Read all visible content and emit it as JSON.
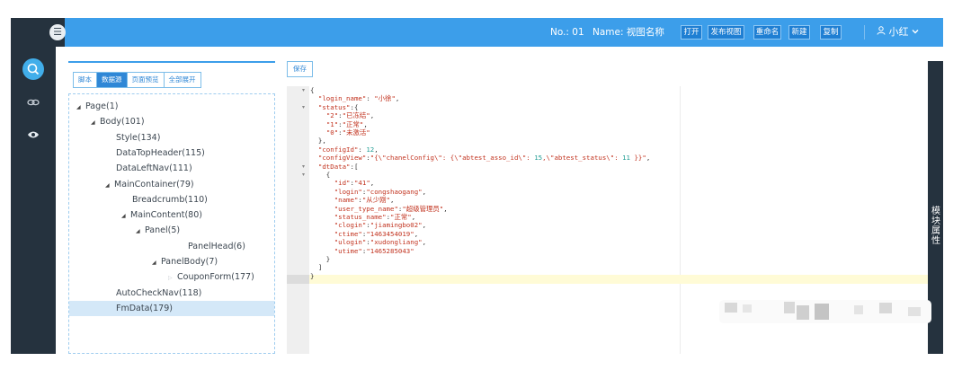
{
  "header": {
    "no_label": "No.: 01",
    "name_label": "Name: 视图名称",
    "buttons": [
      "打开",
      "发布视图",
      "重命名",
      "新建",
      "复制"
    ],
    "user": "小红",
    "menu_icon": "menu-icon",
    "user_icon": "user-icon",
    "dropdown_icon": "chevron-down-icon"
  },
  "sidebar": {
    "items": [
      {
        "icon": "search-icon",
        "active": true
      },
      {
        "icon": "link-icon",
        "active": false
      },
      {
        "icon": "eye-icon",
        "active": false
      }
    ]
  },
  "left_panel": {
    "tabs": [
      "脚本",
      "数据源",
      "页面预览",
      "全部展开"
    ],
    "active_tab": "数据源",
    "tree": [
      {
        "label": "Page(1)",
        "caret": "open"
      },
      {
        "label": "Body(101)",
        "caret": "open"
      },
      {
        "label": "Style(134)",
        "caret": "none"
      },
      {
        "label": "DataTopHeader(115)",
        "caret": "none"
      },
      {
        "label": "DataLeftNav(111)",
        "caret": "none"
      },
      {
        "label": "MainContainer(79)",
        "caret": "open"
      },
      {
        "label": "Breadcrumb(110)",
        "caret": "none"
      },
      {
        "label": "MainContent(80)",
        "caret": "open"
      },
      {
        "label": "Panel(5)",
        "caret": "open"
      },
      {
        "label": "PanelHead(6)",
        "caret": "none"
      },
      {
        "label": "PanelBody(7)",
        "caret": "open"
      },
      {
        "label": "CouponForm(177)",
        "caret": "closed"
      },
      {
        "label": "AutoCheckNav(118)",
        "caret": "none"
      },
      {
        "label": "FmData(179)",
        "caret": "none",
        "selected": true
      }
    ]
  },
  "editor": {
    "save_label": "保存",
    "lines": [
      "{",
      "  \"login_name\": \"小徐\",",
      "  \"status\":{",
      "    \"2\":\"已冻结\",",
      "    \"1\":\"正常\",",
      "    \"0\":\"未激活\"",
      "  },",
      "  \"configId\": 12,",
      "  \"configView\":\"{\\\"chanelConfig\\\": {\\\"abtest_asso_id\\\": 15,\\\"abtest_status\\\": 11 }}\",",
      "  \"dtData\":[",
      "    {",
      "      \"id\":\"41\",",
      "      \"login\":\"congshaogang\",",
      "      \"name\":\"从少刚\",",
      "      \"user_type_name\":\"超级管理员\",",
      "      \"status_name\":\"正常\",",
      "      \"clogin\":\"jiamingbo02\",",
      "      \"ctime\":\"1463454019\",",
      "      \"ulogin\":\"xudongliang\",",
      "      \"utime\":\"1465285043\"",
      "    }",
      "  ]",
      "}"
    ],
    "active_line": 18
  },
  "right_panel": {
    "label": "模块属性"
  },
  "colors": {
    "topbar": "#3c9eea",
    "dark": "#25323e",
    "accent": "#2f87d6",
    "selected": "#d4e8f8",
    "string": "#c2331f",
    "number": "#1f9c93"
  }
}
